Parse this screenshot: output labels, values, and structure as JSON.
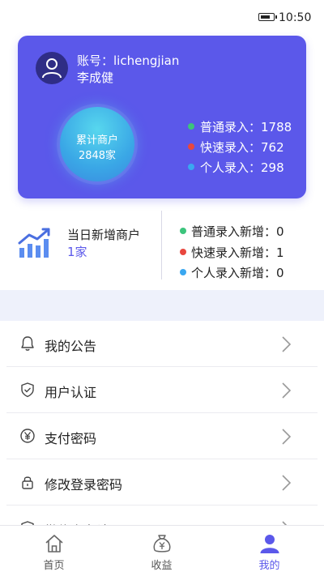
{
  "status_bar": {
    "time": "10:50"
  },
  "account_card": {
    "account_label": "账号：lichengjian",
    "user_name": "李成健",
    "total_merchants_label": "累计商户",
    "total_merchants_count": "2848家",
    "stats": [
      {
        "label": "普通录入：1788",
        "color": "#3cc47c"
      },
      {
        "label": "快速录入：762",
        "color": "#e8473e"
      },
      {
        "label": "个人录入：298",
        "color": "#3aa7f0"
      }
    ]
  },
  "today": {
    "title": "当日新增商户",
    "count": "1家",
    "stats": [
      {
        "label": "普通录入新增：0",
        "color": "#3cc47c"
      },
      {
        "label": "快速录入新增：1",
        "color": "#e8473e"
      },
      {
        "label": "个人录入新增：0",
        "color": "#3aa7f0"
      }
    ]
  },
  "menu": [
    {
      "label": "我的公告",
      "icon": "bell-icon"
    },
    {
      "label": "用户认证",
      "icon": "shield-check-icon"
    },
    {
      "label": "支付密码",
      "icon": "yen-circle-icon"
    },
    {
      "label": "修改登录密码",
      "icon": "lock-icon"
    },
    {
      "label": "微信实名认证",
      "icon": "shield-icon"
    }
  ],
  "bottom_nav": [
    {
      "label": "首页",
      "icon": "home-icon"
    },
    {
      "label": "收益",
      "icon": "money-bag-icon"
    },
    {
      "label": "我的",
      "icon": "user-icon",
      "active": true
    }
  ],
  "colors": {
    "accent": "#5b58ea",
    "band": "#eef1fb"
  }
}
